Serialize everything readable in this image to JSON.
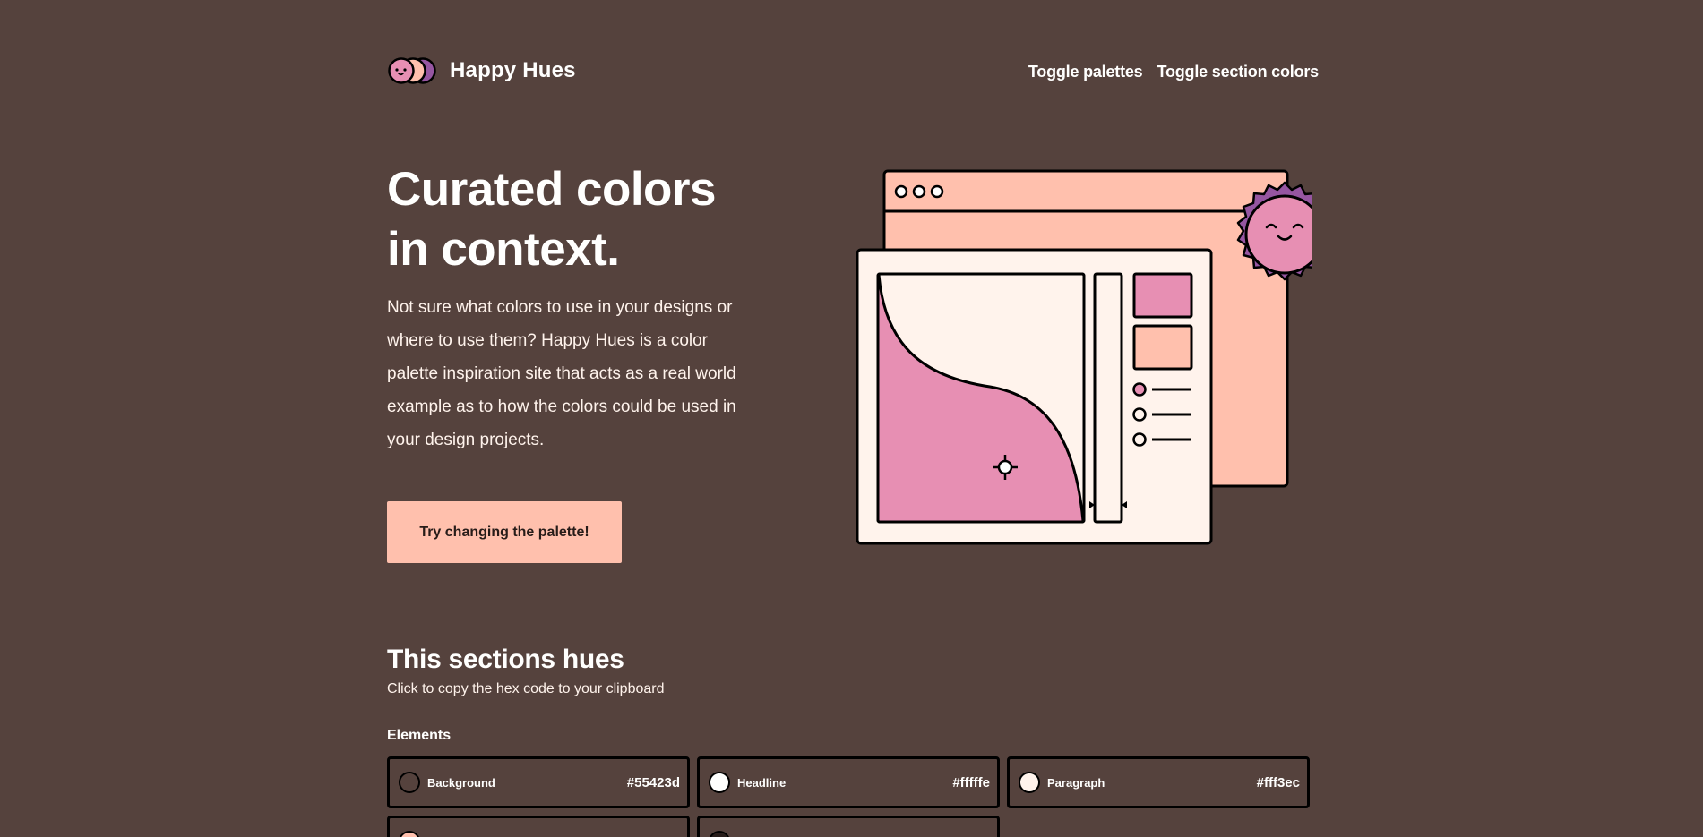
{
  "brand": {
    "name": "Happy Hues"
  },
  "nav": {
    "toggle_palettes": "Toggle palettes",
    "toggle_section_colors": "Toggle section colors"
  },
  "hero": {
    "title_line1": "Curated colors",
    "title_line2": "in context.",
    "paragraph": "Not sure what colors to use in your designs or where to use them? Happy Hues is a color palette inspiration site that acts as a real world example as to how the colors could be used in your design projects.",
    "cta_label": "Try changing the palette!"
  },
  "section": {
    "title": "This sections hues",
    "subtitle": "Click to copy the hex code to your clipboard",
    "elements_label": "Elements",
    "swatches": [
      {
        "name": "Background",
        "hex": "#55423d",
        "color": "#55423d"
      },
      {
        "name": "Headline",
        "hex": "#fffffe",
        "color": "#fffffe"
      },
      {
        "name": "Paragraph",
        "hex": "#fff3ec",
        "color": "#fff3ec"
      },
      {
        "name": "",
        "hex": "",
        "color": "#ffc0ad"
      },
      {
        "name": "",
        "hex": "",
        "color": "#271c19"
      }
    ]
  },
  "colors": {
    "background": "#55423d",
    "headline": "#fffffe",
    "paragraph": "#fff3ec",
    "button": "#ffc0ad",
    "button_text": "#271c19",
    "accent_pink": "#e78fb3",
    "accent_purple": "#9656a1"
  }
}
